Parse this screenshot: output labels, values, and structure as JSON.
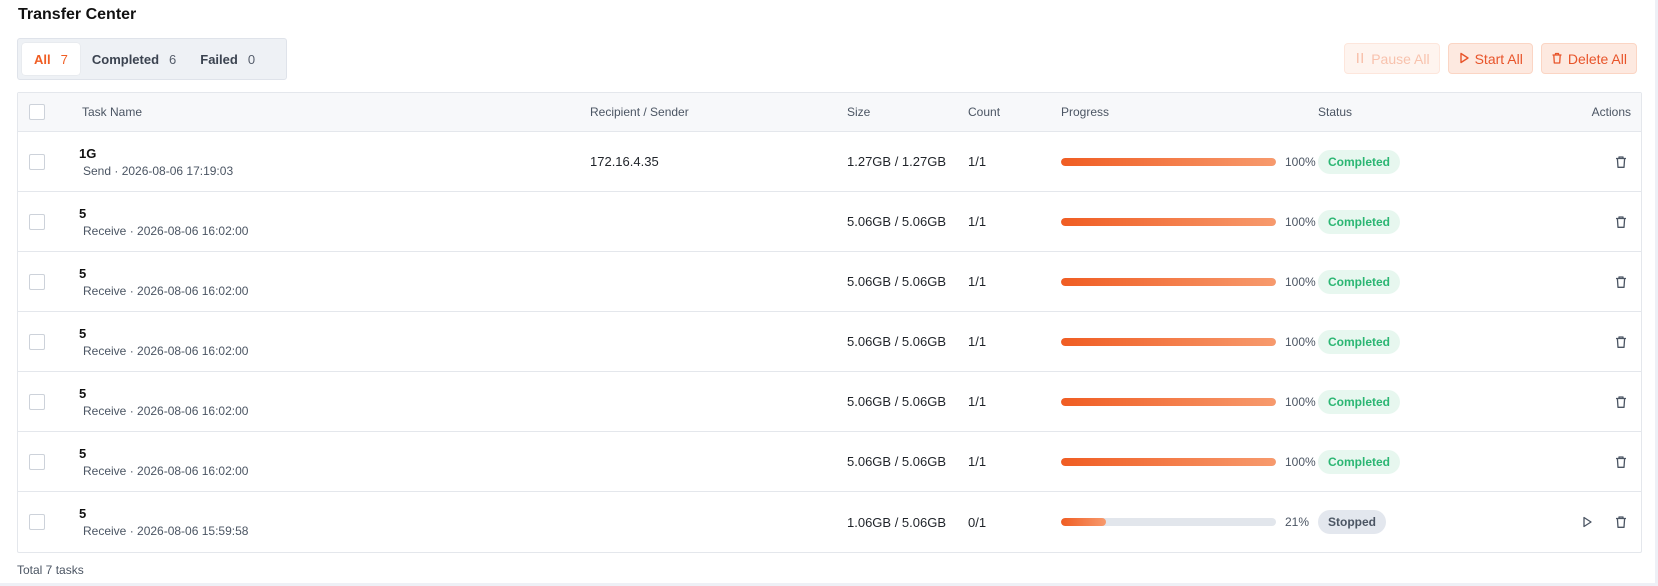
{
  "page": {
    "title": "Transfer Center"
  },
  "tabs": [
    {
      "label": "All",
      "count": "7"
    },
    {
      "label": "Completed",
      "count": "6"
    },
    {
      "label": "Failed",
      "count": "0"
    }
  ],
  "toolbar": {
    "pause_all": "Pause All",
    "start_all": "Start All",
    "delete_all": "Delete All"
  },
  "table": {
    "columns": {
      "task_name": "Task Name",
      "recipient": "Recipient / Sender",
      "size": "Size",
      "count": "Count",
      "progress": "Progress",
      "status": "Status",
      "actions": "Actions"
    },
    "rows": [
      {
        "name": "1G",
        "sub": "Send · 2026-08-06 17:19:03",
        "recipient": "172.16.4.35",
        "size": "1.27GB / 1.27GB",
        "count": "1/1",
        "progress": 100,
        "progress_text": "100%",
        "status": "Completed",
        "status_kind": "ok",
        "can_start": false
      },
      {
        "name": "5",
        "sub": "Receive · 2026-08-06 16:02:00",
        "recipient": "",
        "size": "5.06GB / 5.06GB",
        "count": "1/1",
        "progress": 100,
        "progress_text": "100%",
        "status": "Completed",
        "status_kind": "ok",
        "can_start": false
      },
      {
        "name": "5",
        "sub": "Receive · 2026-08-06 16:02:00",
        "recipient": "",
        "size": "5.06GB / 5.06GB",
        "count": "1/1",
        "progress": 100,
        "progress_text": "100%",
        "status": "Completed",
        "status_kind": "ok",
        "can_start": false
      },
      {
        "name": "5",
        "sub": "Receive · 2026-08-06 16:02:00",
        "recipient": "",
        "size": "5.06GB / 5.06GB",
        "count": "1/1",
        "progress": 100,
        "progress_text": "100%",
        "status": "Completed",
        "status_kind": "ok",
        "can_start": false
      },
      {
        "name": "5",
        "sub": "Receive · 2026-08-06 16:02:00",
        "recipient": "",
        "size": "5.06GB / 5.06GB",
        "count": "1/1",
        "progress": 100,
        "progress_text": "100%",
        "status": "Completed",
        "status_kind": "ok",
        "can_start": false
      },
      {
        "name": "5",
        "sub": "Receive · 2026-08-06 16:02:00",
        "recipient": "",
        "size": "5.06GB / 5.06GB",
        "count": "1/1",
        "progress": 100,
        "progress_text": "100%",
        "status": "Completed",
        "status_kind": "ok",
        "can_start": false
      },
      {
        "name": "5",
        "sub": "Receive · 2026-08-06 15:59:58",
        "recipient": "",
        "size": "1.06GB / 5.06GB",
        "count": "0/1",
        "progress": 21,
        "progress_text": "21%",
        "status": "Stopped",
        "status_kind": "stop",
        "can_start": true
      }
    ]
  },
  "footer": {
    "total": "Total 7 tasks"
  },
  "colors": {
    "accent": "#f05d23",
    "success": "#2bb673",
    "muted": "#4b5563"
  },
  "icons": {
    "pause": "pause-icon",
    "play": "play-icon",
    "trash": "trash-icon"
  }
}
